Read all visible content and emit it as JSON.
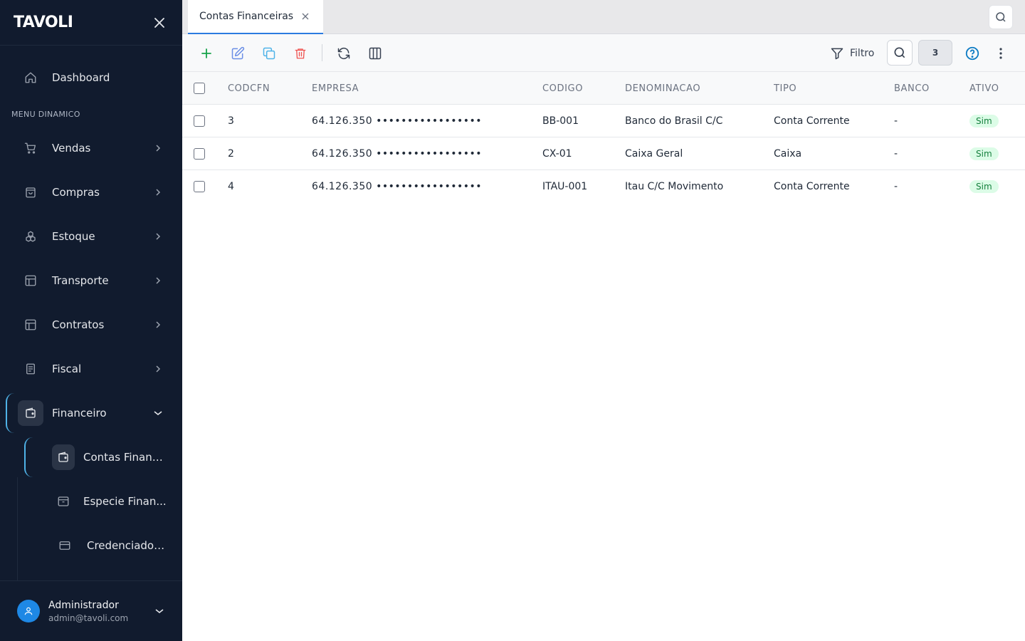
{
  "sidebar": {
    "logo": "TAVOLI",
    "dashboard": "Dashboard",
    "section_label": "MENU DINAMICO",
    "items": [
      {
        "label": "Vendas",
        "icon": "cart-icon"
      },
      {
        "label": "Compras",
        "icon": "bag-icon"
      },
      {
        "label": "Estoque",
        "icon": "boxes-icon"
      },
      {
        "label": "Transporte",
        "icon": "layout-icon"
      },
      {
        "label": "Contratos",
        "icon": "layout-icon"
      },
      {
        "label": "Fiscal",
        "icon": "document-icon"
      },
      {
        "label": "Financeiro",
        "icon": "wallet-icon",
        "expanded": true
      }
    ],
    "sub_items": [
      {
        "label": "Contas Financ...",
        "active": true
      },
      {
        "label": "Especie Finan..."
      },
      {
        "label": "Credenciador..."
      }
    ],
    "user": {
      "name": "Administrador",
      "email": "admin@tavoli.com"
    }
  },
  "tabs": [
    {
      "label": "Contas Financeiras",
      "active": true
    }
  ],
  "toolbar": {
    "filter_label": "Filtro",
    "count": "3"
  },
  "table": {
    "columns": [
      "CODCFN",
      "EMPRESA",
      "CODIGO",
      "DENOMINACAO",
      "TIPO",
      "BANCO",
      "ATIVO"
    ],
    "rows": [
      {
        "codcfn": "3",
        "empresa": "64.126.350 •••••••••••••••••",
        "codigo": "BB-001",
        "denominacao": "Banco do Brasil C/C",
        "tipo": "Conta Corrente",
        "banco": "-",
        "ativo": "Sim"
      },
      {
        "codcfn": "2",
        "empresa": "64.126.350 •••••••••••••••••",
        "codigo": "CX-01",
        "denominacao": "Caixa Geral",
        "tipo": "Caixa",
        "banco": "-",
        "ativo": "Sim"
      },
      {
        "codcfn": "4",
        "empresa": "64.126.350 •••••••••••••••••",
        "codigo": "ITAU-001",
        "denominacao": "Itau C/C Movimento",
        "tipo": "Conta Corrente",
        "banco": "-",
        "ativo": "Sim"
      }
    ]
  },
  "colors": {
    "sidebar_bg": "#111b2e",
    "accent": "#4fb3e8",
    "tab_underline": "#2b7be0",
    "add": "#16a34a",
    "edit": "#6b8fe6",
    "copy": "#4fb3e8",
    "delete": "#ef5350",
    "active_pill_bg": "#dcfce7",
    "active_pill_text": "#15803d"
  }
}
